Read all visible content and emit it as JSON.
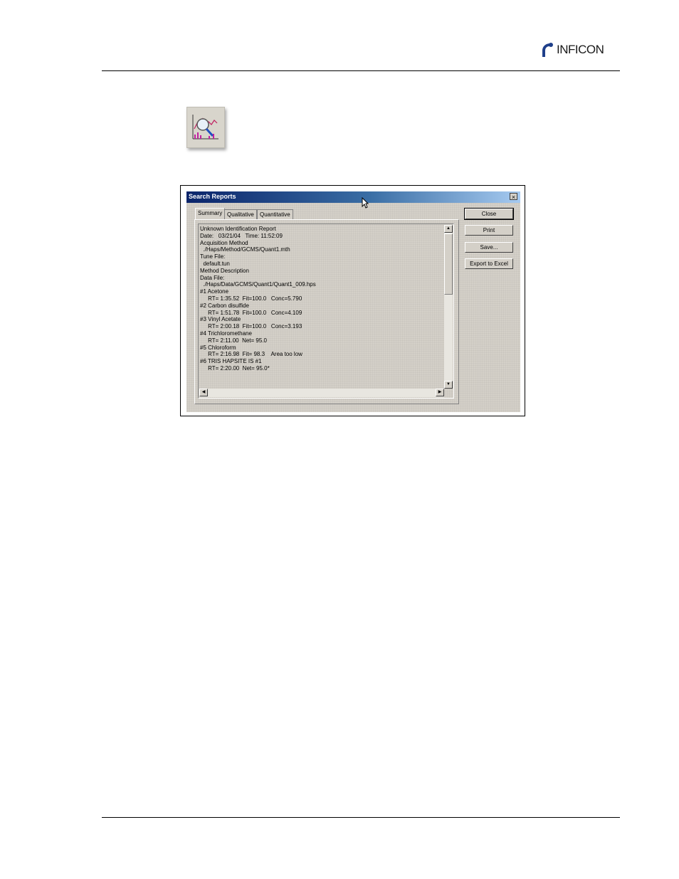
{
  "header": {
    "brand": "INFICON"
  },
  "dialog": {
    "title": "Search Reports",
    "close_glyph": "×",
    "tabs": [
      {
        "label": "Summary",
        "active": true
      },
      {
        "label": "Qualitative",
        "active": false
      },
      {
        "label": "Quantitative",
        "active": false
      }
    ],
    "buttons": {
      "close": "Close",
      "print": "Print",
      "save": "Save...",
      "export": "Export to Excel"
    },
    "report": [
      "Unknown Identification Report",
      "Date:   03/21/04   Time: 11:52:09",
      "Acquisition Method",
      "  ./Haps/Method/GCMS/Quant1.mth",
      "Tune File:",
      "  default.tun",
      "Method Description",
      "",
      "",
      "Data File:",
      "  ./Haps/Data/GCMS/Quant1/Quant1_009.hps",
      "#1 Acetone",
      "     RT= 1:35.52  Fit=100.0   Conc=5.790",
      "#2 Carbon disulfide",
      "     RT= 1:51.78  Fit=100.0   Conc=4.109",
      "#3 Vinyl Acetate",
      "     RT= 2:00.18  Fit=100.0   Conc=3.193",
      "#4 Trichloromethane",
      "     RT= 2:11.00  Net= 95.0",
      "#5 Chloroform",
      "     RT= 2:16.98  Fit= 98.3    Area too low",
      "#6 TRIS HAPSITE IS #1",
      "     RT= 2:20.00  Net= 95.0*"
    ]
  },
  "colors": {
    "titlebar_start": "#0a246a",
    "titlebar_end": "#a6caf0",
    "dialog_face": "#d4d0c8"
  }
}
